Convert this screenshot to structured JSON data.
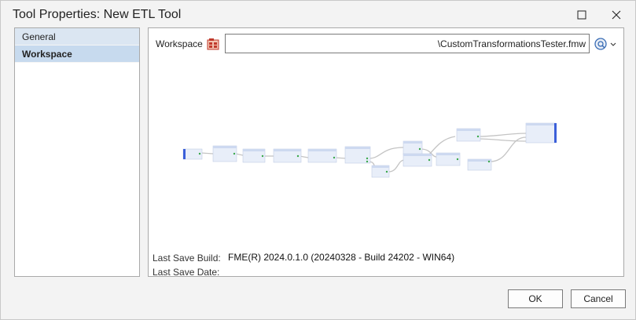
{
  "window": {
    "title": "Tool Properties: New ETL Tool"
  },
  "sidebar": {
    "items": [
      {
        "label": "General",
        "active": false
      },
      {
        "label": "Workspace",
        "active": true
      }
    ]
  },
  "workspace": {
    "label": "Workspace",
    "path_value": "\\CustomTransformationsTester.fmw",
    "last_save_build_label": "Last Save Build:",
    "last_save_build_value": "FME(R) 2024.0.1.0 (20240328 - Build 24202 - WIN64)",
    "last_save_date_label": "Last Save Date:"
  },
  "buttons": {
    "ok": "OK",
    "cancel": "Cancel"
  },
  "icons": {
    "workspace_icon": "fme-workspace-icon",
    "browse_icon": "browse-dropdown-icon",
    "minimize_icon": "maximize-icon",
    "close_icon": "close-icon"
  },
  "colors": {
    "nav_active": "#c7daee",
    "nav_item": "#dbe6f2",
    "node_fill": "#e8eef9",
    "node_header": "#cdd9f0",
    "port_green": "#3aa84a",
    "reader_blue": "#3b5fd9"
  }
}
